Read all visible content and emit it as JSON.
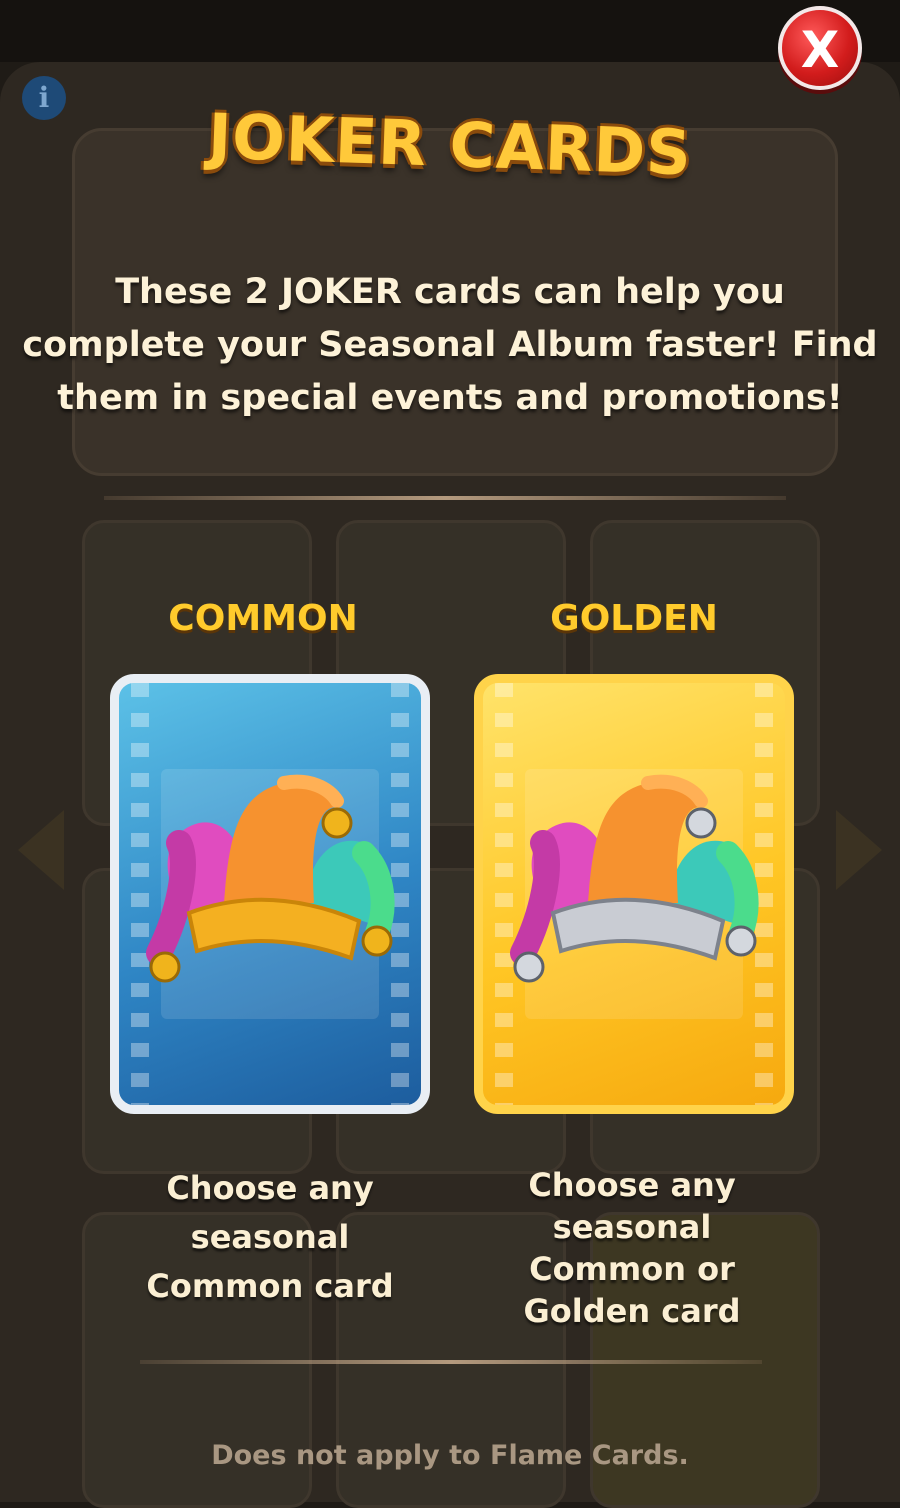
{
  "popup": {
    "title": "JOKER CARDS",
    "close_label": "X",
    "info_label": "i",
    "description": "These 2 JOKER cards can help you complete your Seasonal Album faster! Find them in special events and promotions!",
    "cards": [
      {
        "label": "COMMON",
        "caption_lines": [
          "Choose any",
          "seasonal",
          "Common card"
        ],
        "color": "#2f86c5",
        "icon": "jester-hat-icon"
      },
      {
        "label": "GOLDEN",
        "caption_lines": [
          "Choose any",
          "seasonal",
          "Common or",
          "Golden card"
        ],
        "color": "#ffc624",
        "icon": "jester-hat-icon"
      }
    ],
    "footer_note": "Does not apply to Flame Cards."
  },
  "colors": {
    "title": "#ffc93a",
    "label": "#ffcb2c",
    "text": "#fbefd3",
    "close_button": "#d21c1c"
  }
}
